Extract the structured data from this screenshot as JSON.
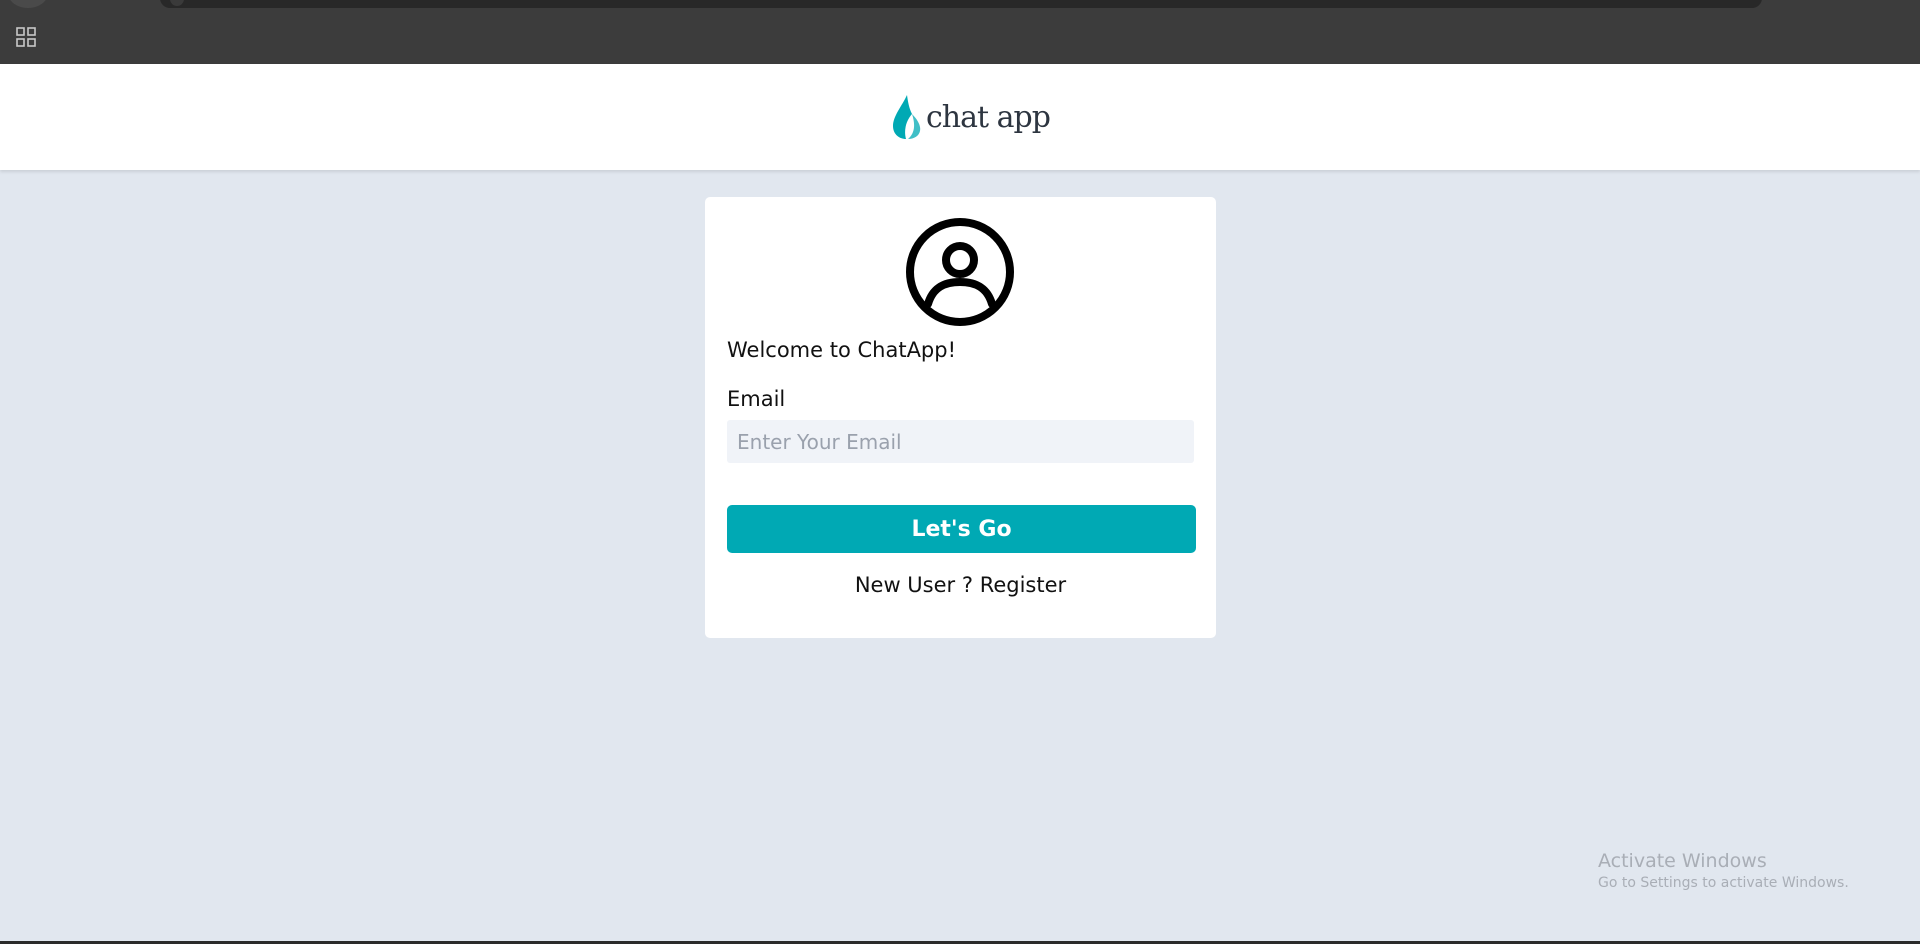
{
  "app": {
    "logo_text": "chat app",
    "brand_color": "#00a9b4",
    "logo_icon": "drop-logo-icon"
  },
  "login": {
    "welcome": "Welcome to ChatApp!",
    "email_label": "Email",
    "email_placeholder": "Enter Your Email",
    "email_value": "",
    "submit_label": "Let's Go",
    "register_prefix": "New User ?",
    "register_link": "Register",
    "avatar_icon": "user-circle-icon"
  },
  "browser": {
    "apps_icon": "apps-grid-icon"
  },
  "watermark": {
    "title": "Activate Windows",
    "subtitle": "Go to Settings to activate Windows."
  }
}
